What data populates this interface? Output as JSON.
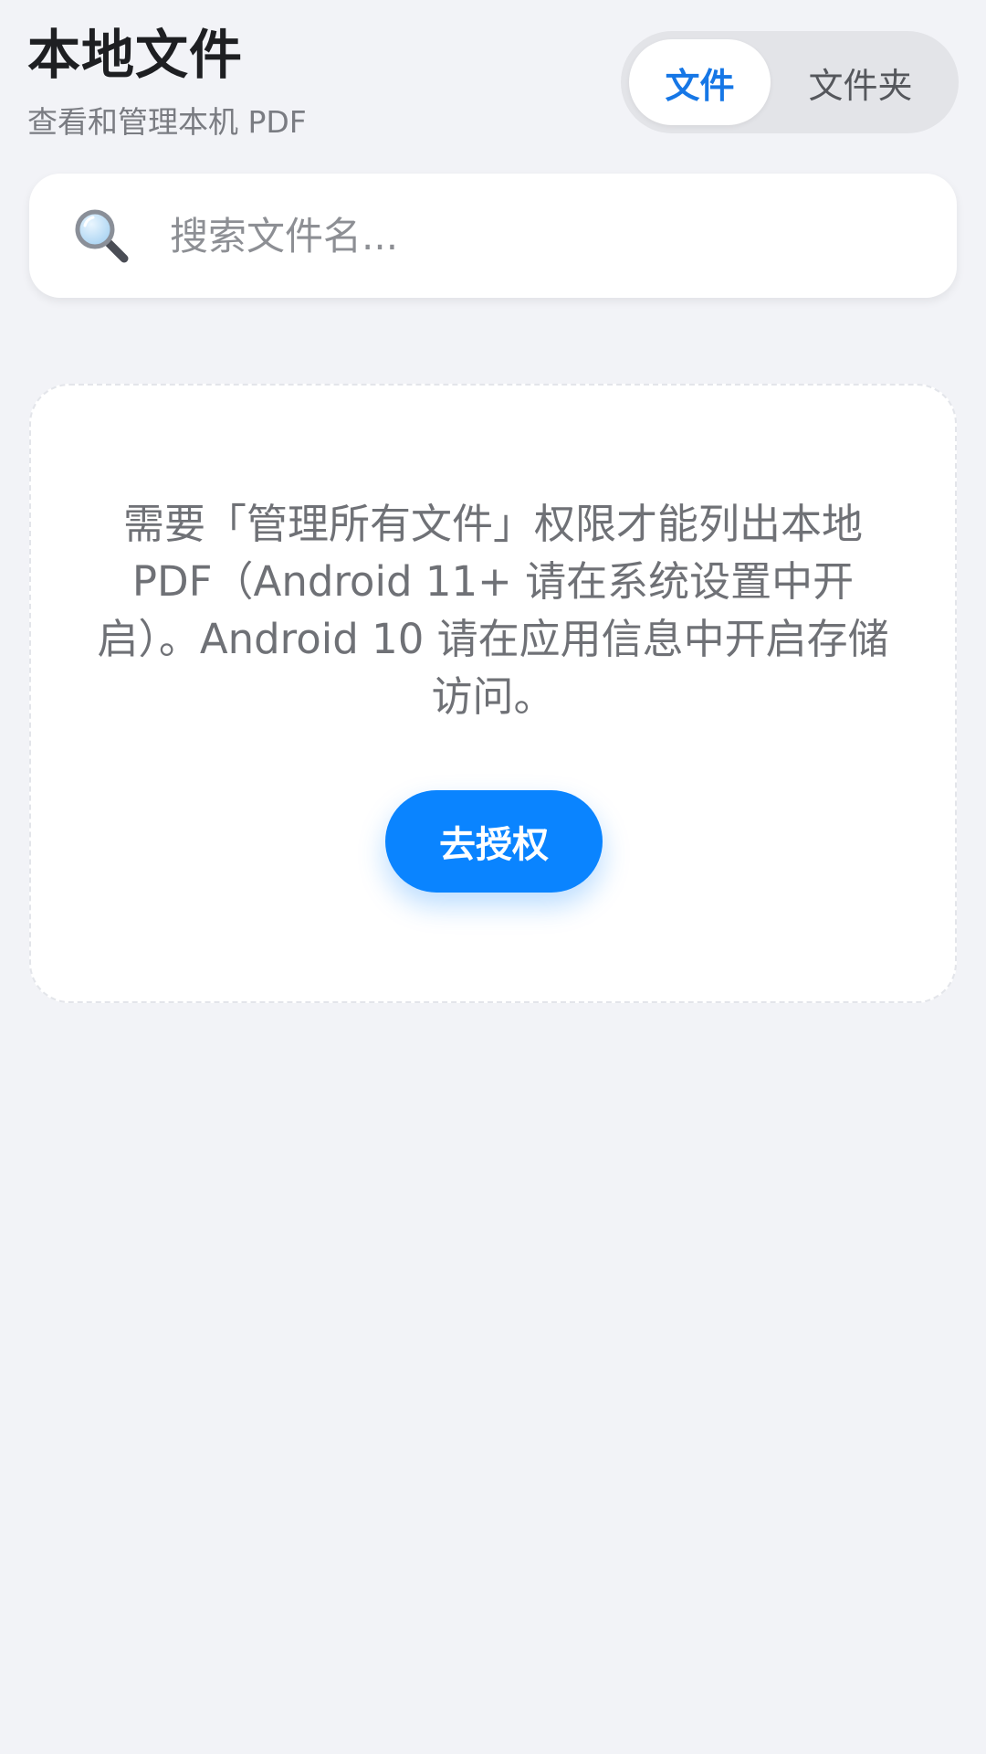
{
  "header": {
    "title": "本地文件",
    "subtitle": "查看和管理本机 PDF"
  },
  "view_toggle": {
    "tabs": [
      {
        "label": "文件",
        "selected": true
      },
      {
        "label": "文件夹",
        "selected": false
      }
    ]
  },
  "search": {
    "icon": "search-icon",
    "placeholder": "搜索文件名..."
  },
  "permission_card": {
    "message": "需要「管理所有文件」权限才能列出本地 PDF（Android 11+ 请在系统设置中开启）。Android 10 请在应用信息中开启存储访问。",
    "button_label": "去授权"
  },
  "colors": {
    "accent": "#0a84ff",
    "active_tab_text": "#1677e6",
    "background": "#f2f3f7"
  }
}
